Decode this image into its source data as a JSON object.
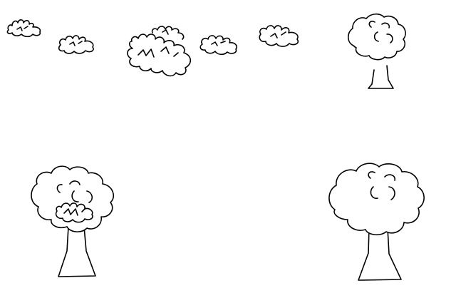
{
  "canvas": {
    "background": "#ffffff",
    "ink_color": "#000000"
  },
  "objects": {
    "clouds": [
      "cloud",
      "cloud",
      "cloud",
      "cloud",
      "cloud",
      "cloud",
      "cloud"
    ],
    "trees": [
      "tree",
      "tree",
      "tree"
    ],
    "bush_on_tree": "bush"
  }
}
